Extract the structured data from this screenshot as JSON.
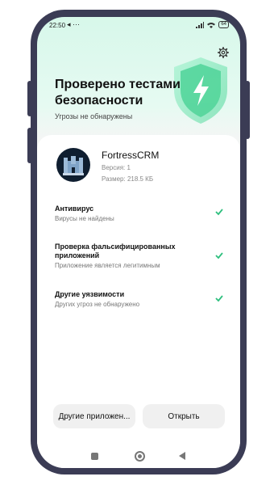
{
  "status_bar": {
    "time": "22:50",
    "left_icons": "◂ ···",
    "battery": "64",
    "colors": {
      "text": "#222222"
    }
  },
  "header": {
    "title": "Проверено тестами безопасности",
    "subtitle": "Угрозы не обнаружены",
    "settings_icon": "gear-icon",
    "shield_icon": "shield-bolt-icon",
    "accent": "#3fd08f"
  },
  "app": {
    "name": "FortressCRM",
    "version": "Версия: 1",
    "size": "Размер: 218.5 КБ",
    "icon": "castle-icon"
  },
  "checks": [
    {
      "title": "Антивирус",
      "desc": "Вирусы не найдены",
      "icon": "check-icon"
    },
    {
      "title": "Проверка фальсифицированных приложений",
      "desc": "Приложение является легитимным",
      "icon": "check-icon"
    },
    {
      "title": "Другие уязвимости",
      "desc": "Других угроз не обнаружено",
      "icon": "check-icon"
    }
  ],
  "buttons": {
    "other_apps": "Другие приложен...",
    "open": "Открыть"
  },
  "nav": {
    "recents_icon": "square-icon",
    "home_icon": "circle-icon",
    "back_icon": "triangle-back-icon"
  }
}
